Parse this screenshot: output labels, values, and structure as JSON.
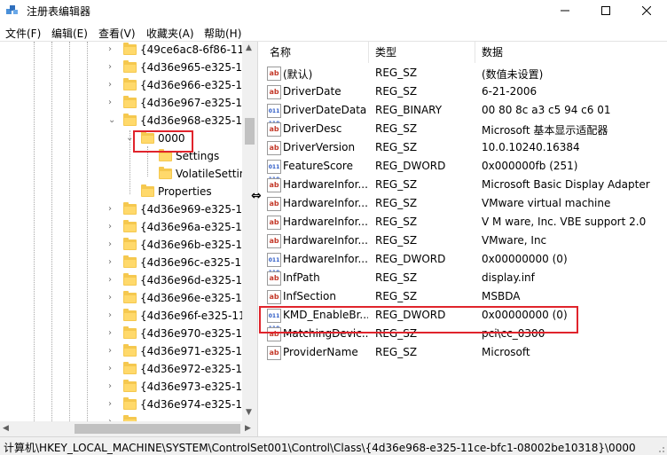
{
  "window": {
    "title": "注册表编辑器",
    "minimize_icon": "minimize-icon",
    "maximize_icon": "maximize-icon",
    "close_icon": "close-icon"
  },
  "menu": [
    "文件(F)",
    "编辑(E)",
    "查看(V)",
    "收藏夹(A)",
    "帮助(H)"
  ],
  "tree": {
    "items": [
      {
        "label": "{49ce6ac8-6f86-11d",
        "level": 0,
        "expander": "collapsed"
      },
      {
        "label": "{4d36e965-e325-11",
        "level": 0,
        "expander": "collapsed"
      },
      {
        "label": "{4d36e966-e325-11",
        "level": 0,
        "expander": "collapsed"
      },
      {
        "label": "{4d36e967-e325-11",
        "level": 0,
        "expander": "collapsed"
      },
      {
        "label": "{4d36e968-e325-11",
        "level": 0,
        "expander": "expanded"
      },
      {
        "label": "0000",
        "level": 1,
        "expander": "expanded",
        "selected": true
      },
      {
        "label": "Settings",
        "level": 2,
        "expander": "none"
      },
      {
        "label": "VolatileSettin",
        "level": 2,
        "expander": "none"
      },
      {
        "label": "Properties",
        "level": 1,
        "expander": "none"
      },
      {
        "label": "{4d36e969-e325-11",
        "level": 0,
        "expander": "collapsed"
      },
      {
        "label": "{4d36e96a-e325-11",
        "level": 0,
        "expander": "collapsed"
      },
      {
        "label": "{4d36e96b-e325-11",
        "level": 0,
        "expander": "collapsed"
      },
      {
        "label": "{4d36e96c-e325-11",
        "level": 0,
        "expander": "collapsed"
      },
      {
        "label": "{4d36e96d-e325-11",
        "level": 0,
        "expander": "collapsed"
      },
      {
        "label": "{4d36e96e-e325-11",
        "level": 0,
        "expander": "collapsed"
      },
      {
        "label": "{4d36e96f-e325-11c",
        "level": 0,
        "expander": "collapsed"
      },
      {
        "label": "{4d36e970-e325-11",
        "level": 0,
        "expander": "collapsed"
      },
      {
        "label": "{4d36e971-e325-11",
        "level": 0,
        "expander": "collapsed"
      },
      {
        "label": "{4d36e972-e325-11",
        "level": 0,
        "expander": "collapsed"
      },
      {
        "label": "{4d36e973-e325-11",
        "level": 0,
        "expander": "collapsed"
      },
      {
        "label": "{4d36e974-e325-11",
        "level": 0,
        "expander": "collapsed"
      },
      {
        "label": "",
        "level": 0,
        "expander": "collapsed"
      }
    ]
  },
  "list": {
    "headers": {
      "name": "名称",
      "type": "类型",
      "data": "数据"
    },
    "rows": [
      {
        "icon": "string-value-icon",
        "name": "(默认)",
        "type": "REG_SZ",
        "data": "(数值未设置)"
      },
      {
        "icon": "string-value-icon",
        "name": "DriverDate",
        "type": "REG_SZ",
        "data": "6-21-2006"
      },
      {
        "icon": "binary-value-icon",
        "name": "DriverDateData",
        "type": "REG_BINARY",
        "data": "00 80 8c a3 c5 94 c6 01"
      },
      {
        "icon": "string-value-icon",
        "name": "DriverDesc",
        "type": "REG_SZ",
        "data": "Microsoft 基本显示适配器"
      },
      {
        "icon": "string-value-icon",
        "name": "DriverVersion",
        "type": "REG_SZ",
        "data": "10.0.10240.16384"
      },
      {
        "icon": "binary-value-icon",
        "name": "FeatureScore",
        "type": "REG_DWORD",
        "data": "0x000000fb (251)"
      },
      {
        "icon": "string-value-icon",
        "name": "HardwareInfor...",
        "type": "REG_SZ",
        "data": "Microsoft Basic Display Adapter"
      },
      {
        "icon": "string-value-icon",
        "name": "HardwareInfor...",
        "type": "REG_SZ",
        "data": "VMware virtual machine"
      },
      {
        "icon": "string-value-icon",
        "name": "HardwareInfor...",
        "type": "REG_SZ",
        "data": "V M ware, Inc. VBE support 2.0"
      },
      {
        "icon": "string-value-icon",
        "name": "HardwareInfor...",
        "type": "REG_SZ",
        "data": "VMware, Inc"
      },
      {
        "icon": "binary-value-icon",
        "name": "HardwareInfor...",
        "type": "REG_DWORD",
        "data": "0x00000000 (0)"
      },
      {
        "icon": "string-value-icon",
        "name": "InfPath",
        "type": "REG_SZ",
        "data": "display.inf"
      },
      {
        "icon": "string-value-icon",
        "name": "InfSection",
        "type": "REG_SZ",
        "data": "MSBDA"
      },
      {
        "icon": "binary-value-icon",
        "name": "KMD_EnableBr...",
        "type": "REG_DWORD",
        "data": "0x00000000 (0)"
      },
      {
        "icon": "string-value-icon",
        "name": "MatchingDevic...",
        "type": "REG_SZ",
        "data": "pci\\cc_0300"
      },
      {
        "icon": "string-value-icon",
        "name": "ProviderName",
        "type": "REG_SZ",
        "data": "Microsoft"
      }
    ]
  },
  "status": {
    "path": "计算机\\HKEY_LOCAL_MACHINE\\SYSTEM\\ControlSet001\\Control\\Class\\{4d36e968-e325-11ce-bfc1-08002be10318}\\0000"
  },
  "colors": {
    "highlight_box": "#e0242c",
    "folder": "#f5c84f"
  }
}
